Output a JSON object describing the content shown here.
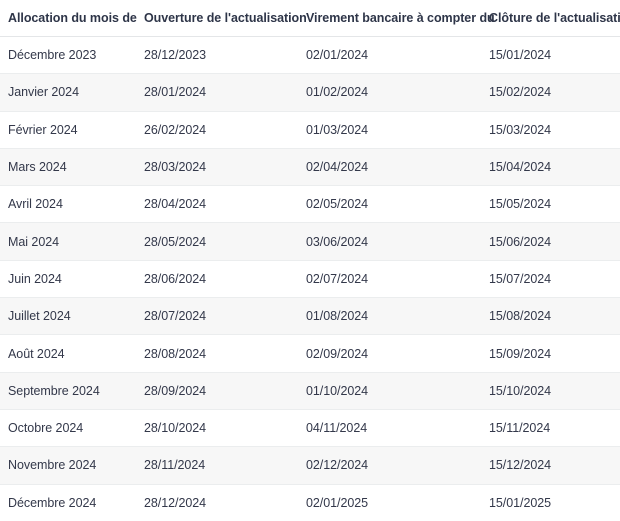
{
  "table": {
    "columns": [
      "Allocation du mois de",
      "Ouverture de l'actualisation",
      "Virement bancaire à compter du",
      "Clôture de l'actualisation"
    ],
    "rows": [
      [
        "Décembre 2023",
        "28/12/2023",
        "02/01/2024",
        "15/01/2024"
      ],
      [
        "Janvier 2024",
        "28/01/2024",
        "01/02/2024",
        "15/02/2024"
      ],
      [
        "Février 2024",
        "26/02/2024",
        "01/03/2024",
        "15/03/2024"
      ],
      [
        "Mars 2024",
        "28/03/2024",
        "02/04/2024",
        "15/04/2024"
      ],
      [
        "Avril 2024",
        "28/04/2024",
        "02/05/2024",
        "15/05/2024"
      ],
      [
        "Mai 2024",
        "28/05/2024",
        "03/06/2024",
        "15/06/2024"
      ],
      [
        "Juin 2024",
        "28/06/2024",
        "02/07/2024",
        "15/07/2024"
      ],
      [
        "Juillet 2024",
        "28/07/2024",
        "01/08/2024",
        "15/08/2024"
      ],
      [
        "Août 2024",
        "28/08/2024",
        "02/09/2024",
        "15/09/2024"
      ],
      [
        "Septembre 2024",
        "28/09/2024",
        "01/10/2024",
        "15/10/2024"
      ],
      [
        "Octobre 2024",
        "28/10/2024",
        "04/11/2024",
        "15/11/2024"
      ],
      [
        "Novembre 2024",
        "28/11/2024",
        "02/12/2024",
        "15/12/2024"
      ],
      [
        "Décembre 2024",
        "28/12/2024",
        "02/01/2025",
        "15/01/2025"
      ]
    ]
  },
  "colors": {
    "header_text": "#2e3548",
    "body_text": "#33384a",
    "row_even_bg": "#f7f7f7",
    "row_odd_bg": "#ffffff",
    "row_border": "#ebedee",
    "header_border": "#e4e6e8"
  }
}
